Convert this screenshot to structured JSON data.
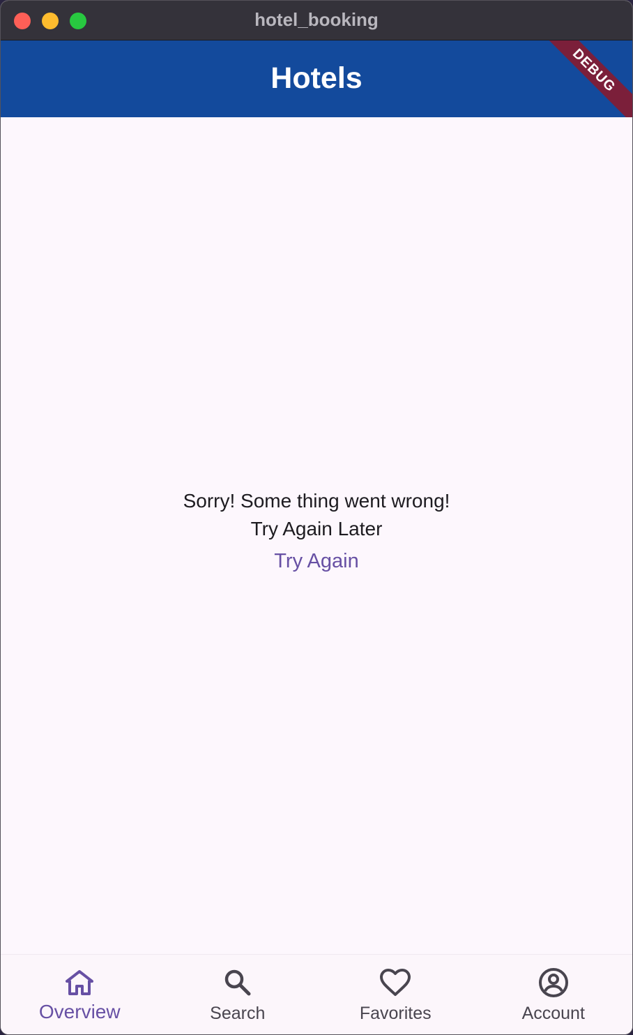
{
  "window": {
    "title": "hotel_booking"
  },
  "appbar": {
    "title": "Hotels",
    "debug_label": "DEBUG"
  },
  "error": {
    "line1": "Sorry! Some thing went wrong!",
    "line2": "Try Again Later",
    "retry_label": "Try Again"
  },
  "navbar": {
    "items": [
      {
        "label": "Overview",
        "icon": "home-icon",
        "active": true
      },
      {
        "label": "Search",
        "icon": "search-icon",
        "active": false
      },
      {
        "label": "Favorites",
        "icon": "heart-icon",
        "active": false
      },
      {
        "label": "Account",
        "icon": "account-circle-icon",
        "active": false
      }
    ]
  },
  "colors": {
    "appbar": "#134a9c",
    "accent": "#6750a4",
    "background": "#fdf7fd",
    "debug_banner": "#7b1f3a"
  }
}
